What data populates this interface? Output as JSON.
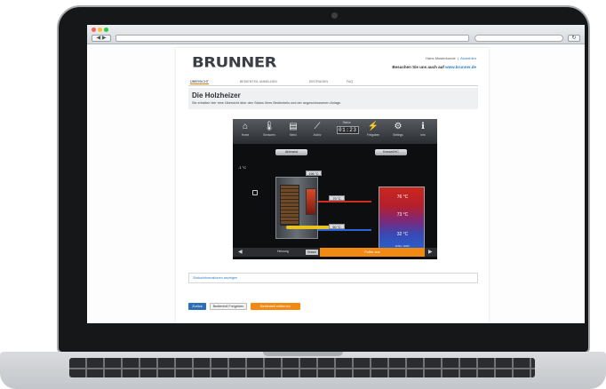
{
  "browser": {
    "nav_label": "◀ ▶",
    "reload_label": "↻",
    "dot_colors": [
      "#ff5f56",
      "#ffbd2e",
      "#27c93f"
    ]
  },
  "brand": {
    "logo": "BRUNNER"
  },
  "account": {
    "user": "Hans Musterkunde",
    "login_link": "Abmelden"
  },
  "promo": {
    "text": "Besuchen Sie uns auch auf",
    "link": "www.brunner.de"
  },
  "tabs": [
    {
      "label": "Übersicht"
    },
    {
      "label": "Bedienteil anmelden"
    },
    {
      "label": "Eintragen"
    },
    {
      "label": "FAQ"
    }
  ],
  "page": {
    "title": "Die Holzheizer",
    "subtitle": "Sie erhalten hier eine Übersicht über den Status Ihres Bedienteils und der angeschlossenen Anlage."
  },
  "controller": {
    "menu": [
      {
        "icon": "home-icon",
        "glyph": "⌂",
        "label": "Home"
      },
      {
        "icon": "thermometer-icon",
        "glyph": "🌡",
        "label": "Sensoren"
      },
      {
        "icon": "menu-icon",
        "glyph": "▤",
        "label": "Menü"
      },
      {
        "icon": "chart-icon",
        "glyph": "⟋",
        "label": "Archiv"
      },
      {
        "icon": "status-icon",
        "glyph": "",
        "label": "Status"
      },
      {
        "icon": "plug-icon",
        "glyph": "⚡",
        "label": "Freigaben"
      },
      {
        "icon": "settings-icon",
        "glyph": "⚙",
        "label": "Settings"
      },
      {
        "icon": "info-icon",
        "glyph": "ℹ",
        "label": "Info"
      }
    ],
    "clock": "01:23",
    "left_button": "Abbrand",
    "right_button": "Kessel/HC",
    "outdoor_temp": "-1 °C",
    "flue_temp": "196 °C",
    "flow_temp": "79 °C",
    "return_temp": "60 °C",
    "tank_top": "76 °C",
    "tank_mid": "73 °C",
    "tank_bottom": "32 °C",
    "tank_info": "Puffer • 2000 l",
    "bottom_left": "Heizung",
    "bottom_tag": "Kessel",
    "bottom_status": "Puffer aus",
    "colors": {
      "hot": "#d32a1f",
      "cold": "#2b63d9",
      "accent": "#f08a12"
    }
  },
  "info": {
    "link": "Statusinformationen anzeigen"
  },
  "buttons": {
    "back": "Zurück",
    "release": "Bedienteil Freigeben",
    "remove": "Bedienteil entfernen"
  }
}
